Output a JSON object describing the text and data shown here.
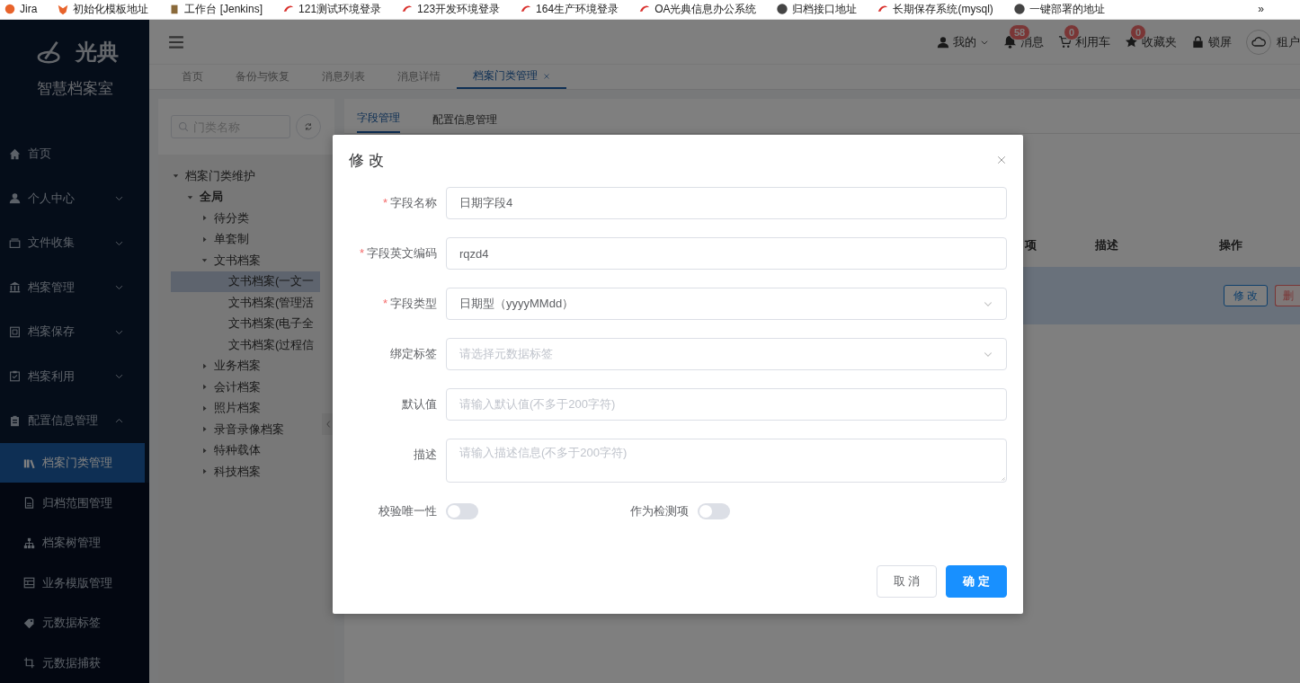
{
  "bookmarks": [
    {
      "label": "Jira"
    },
    {
      "label": "初始化模板地址"
    },
    {
      "label": "工作台 [Jenkins]"
    },
    {
      "label": "121测试环境登录"
    },
    {
      "label": "123开发环境登录"
    },
    {
      "label": "164生产环境登录"
    },
    {
      "label": "OA光典信息办公系统"
    },
    {
      "label": "归档接口地址"
    },
    {
      "label": "长期保存系统(mysql)"
    },
    {
      "label": "一键部署的地址"
    }
  ],
  "bookmarks_more": "»",
  "sidebar": {
    "logo": "光典",
    "subtitle": "智慧档案室",
    "items": [
      {
        "label": "首页",
        "kind": "link"
      },
      {
        "label": "个人中心",
        "kind": "group",
        "expanded": false
      },
      {
        "label": "文件收集",
        "kind": "group",
        "expanded": false
      },
      {
        "label": "档案管理",
        "kind": "group",
        "expanded": false
      },
      {
        "label": "档案保存",
        "kind": "group",
        "expanded": false
      },
      {
        "label": "档案利用",
        "kind": "group",
        "expanded": false
      },
      {
        "label": "配置信息管理",
        "kind": "group",
        "expanded": true,
        "children": [
          {
            "label": "档案门类管理",
            "selected": true
          },
          {
            "label": "归档范围管理",
            "selected": false
          },
          {
            "label": "档案树管理",
            "selected": false
          },
          {
            "label": "业务模版管理",
            "selected": false
          },
          {
            "label": "元数据标签",
            "selected": false
          },
          {
            "label": "元数据捕获",
            "selected": false
          }
        ]
      }
    ]
  },
  "header": {
    "user": "我的",
    "actions": [
      {
        "label": "消息",
        "badge": "58"
      },
      {
        "label": "利用车",
        "badge": "0"
      },
      {
        "label": "收藏夹",
        "badge": "0"
      },
      {
        "label": "锁屏"
      }
    ],
    "tenant": "租户"
  },
  "tabs": [
    {
      "label": "首页",
      "selected": false
    },
    {
      "label": "备份与恢复",
      "selected": false
    },
    {
      "label": "消息列表",
      "selected": false
    },
    {
      "label": "消息详情",
      "selected": false
    },
    {
      "label": "档案门类管理",
      "selected": true
    }
  ],
  "category_panel": {
    "search": {
      "placeholder": "门类名称"
    },
    "tree": [
      {
        "label": "档案门类维护",
        "expanded": true,
        "selected": false,
        "children": [
          {
            "label": "全局",
            "expanded": true,
            "selected": false,
            "children": [
              {
                "label": "待分类",
                "expanded": false,
                "selected": false
              },
              {
                "label": "单套制",
                "expanded": false,
                "selected": false
              },
              {
                "label": "文书档案",
                "expanded": true,
                "selected": false,
                "children": [
                  {
                    "label": "文书档案(一文一",
                    "selected": true
                  },
                  {
                    "label": "文书档案(管理活",
                    "selected": false
                  },
                  {
                    "label": "文书档案(电子全",
                    "selected": false
                  },
                  {
                    "label": "文书档案(过程信",
                    "selected": false
                  }
                ]
              },
              {
                "label": "业务档案",
                "expanded": false,
                "selected": false
              },
              {
                "label": "会计档案",
                "expanded": false,
                "selected": false
              },
              {
                "label": "照片档案",
                "expanded": false,
                "selected": false
              },
              {
                "label": "录音录像档案",
                "expanded": false,
                "selected": false
              },
              {
                "label": "特种载体",
                "expanded": false,
                "selected": false
              },
              {
                "label": "科技档案",
                "expanded": false,
                "selected": false
              }
            ]
          }
        ]
      }
    ]
  },
  "content": {
    "tabs": [
      {
        "label": "字段管理",
        "selected": true
      },
      {
        "label": "配置信息管理",
        "selected": false
      }
    ],
    "table": {
      "columns": [
        {
          "label": "项"
        },
        {
          "label": "描述"
        },
        {
          "label": "操作"
        }
      ],
      "rows": [
        {
          "selected": true,
          "actions": [
            {
              "label": "修 改",
              "kind": "edit"
            },
            {
              "label": "删",
              "kind": "delete"
            }
          ]
        }
      ]
    }
  },
  "modal": {
    "title": "修 改",
    "fields": [
      {
        "kind": "input",
        "required_mark": "*",
        "label": "字段名称",
        "value": "日期字段4"
      },
      {
        "kind": "input",
        "required_mark": "*",
        "label": "字段英文编码",
        "value": "rqzd4"
      },
      {
        "kind": "select",
        "required_mark": "*",
        "label": "字段类型",
        "value": "日期型（yyyyMMdd）"
      },
      {
        "kind": "select",
        "label": "绑定标签",
        "placeholder": "请选择元数据标签"
      },
      {
        "kind": "input",
        "label": "默认值",
        "placeholder": "请输入默认值(不多于200字符)"
      },
      {
        "kind": "textarea",
        "label": "描述",
        "placeholder": "请输入描述信息(不多于200字符)"
      }
    ],
    "switches": [
      {
        "label": "校验唯一性",
        "on": false
      },
      {
        "label": "作为检测项",
        "on": false
      }
    ],
    "buttons": [
      {
        "label": "取 消",
        "kind": "default"
      },
      {
        "label": "确 定",
        "kind": "primary"
      }
    ]
  }
}
